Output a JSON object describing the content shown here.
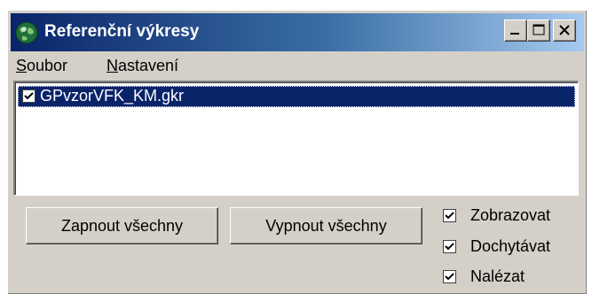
{
  "window": {
    "title": "Referenční výkresy",
    "icon": "globe-icon",
    "controls": [
      "minimize-icon",
      "maximize-icon",
      "close-icon"
    ]
  },
  "menu": {
    "soubor": {
      "accel": "S",
      "rest": "oubor"
    },
    "nastaveni": {
      "accel": "N",
      "rest": "astavení"
    }
  },
  "list": {
    "items": [
      {
        "label": "GPvzorVFK_KM.gkr",
        "checked": true,
        "selected": true
      }
    ]
  },
  "buttons": {
    "enable_all": "Zapnout všechny",
    "disable_all": "Vypnout všechny"
  },
  "options": {
    "show": {
      "label": "Zobrazovat",
      "checked": true
    },
    "snap": {
      "label": "Dochytávat",
      "checked": true
    },
    "find": {
      "label": "Nalézat",
      "checked": true
    }
  },
  "colors": {
    "title_gradient_start": "#0a246a",
    "title_gradient_end": "#a6caf0",
    "selection": "#0a246a",
    "face": "#d4d0c8"
  }
}
